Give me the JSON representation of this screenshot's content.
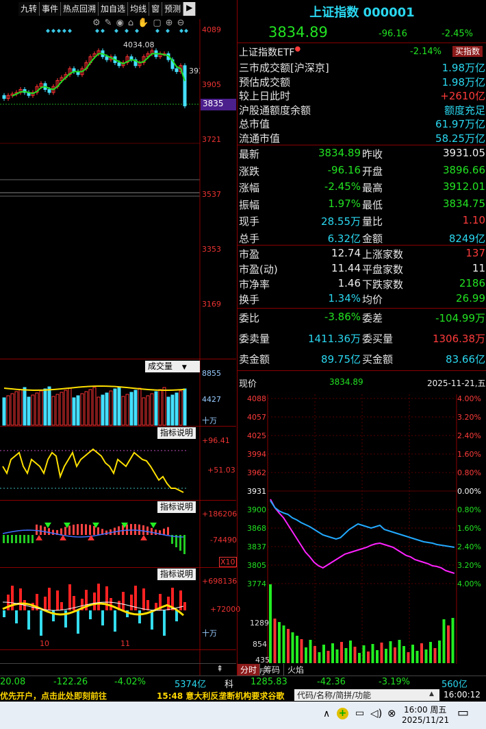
{
  "toolbar": [
    "九转",
    "事件",
    "热点回溯",
    "加自选",
    "均线",
    "窗",
    "预测",
    "▶"
  ],
  "kline": {
    "price_labels": [
      "4089",
      "3905",
      "3721",
      "3537",
      "3353",
      "3169"
    ],
    "current_tag": "3835",
    "high_annot": "4034.08",
    "right_annot": "393",
    "month_labels": [
      "10",
      "11"
    ]
  },
  "volume": {
    "btn": "成交量",
    "labels": [
      "8855",
      "4427"
    ],
    "unit": "十万"
  },
  "ind1": {
    "btn": "指标说明",
    "labels": [
      "+96.41",
      "+51.03"
    ]
  },
  "ind2": {
    "btn": "指标说明",
    "labels": [
      "+186206",
      "-74490"
    ],
    "x10": "X10"
  },
  "ind3": {
    "btn": "指标说明",
    "labels": [
      "+698136",
      "+72000"
    ],
    "unit": "十万"
  },
  "header": {
    "title": "上证指数 000001",
    "price": "3834.89",
    "change": "-96.16",
    "pct": "-2.45%"
  },
  "etf": {
    "label": "上证指数ETF",
    "pct": "-2.14%",
    "btn": "买指数"
  },
  "market": [
    {
      "label": "三市成交额[沪深京]",
      "value": "1.98万亿"
    },
    {
      "label": "预估成交额",
      "value": "1.98万亿"
    },
    {
      "label": "较上日此时",
      "value": "+2610亿"
    },
    {
      "label": "沪股通额度余额",
      "value": "额度充足"
    },
    {
      "label": "总市值",
      "value": "61.97万亿"
    },
    {
      "label": "流通市值",
      "value": "58.25万亿"
    }
  ],
  "quote": [
    {
      "l1": "最新",
      "v1": "3834.89",
      "l2": "昨收",
      "v2": "3931.05"
    },
    {
      "l1": "涨跌",
      "v1": "-96.16",
      "l2": "开盘",
      "v2": "3896.66"
    },
    {
      "l1": "涨幅",
      "v1": "-2.45%",
      "l2": "最高",
      "v2": "3912.01"
    },
    {
      "l1": "振幅",
      "v1": "1.97%",
      "l2": "最低",
      "v2": "3834.75"
    },
    {
      "l1": "现手",
      "v1": "28.55万",
      "l2": "量比",
      "v2": "1.10"
    },
    {
      "l1": "总手",
      "v1": "6.32亿",
      "l2": "金额",
      "v2": "8249亿"
    }
  ],
  "stats": [
    {
      "l1": "市盈",
      "v1": "12.74",
      "l2": "上涨家数",
      "v2": "137"
    },
    {
      "l1": "市盈(动)",
      "v1": "11.44",
      "l2": "平盘家数",
      "v2": "11"
    },
    {
      "l1": "市净率",
      "v1": "1.46",
      "l2": "下跌家数",
      "v2": "2186"
    },
    {
      "l1": "换手",
      "v1": "1.34%",
      "l2": "均价",
      "v2": "26.99"
    }
  ],
  "order": [
    {
      "l1": "委比",
      "v1": "-3.86%",
      "l2": "委差",
      "v2": "-104.99万"
    },
    {
      "l1": "委卖量",
      "v1": "1411.36万",
      "l2": "委买量",
      "v2": "1306.38万"
    },
    {
      "l1": "卖金额",
      "v1": "89.75亿",
      "l2": "买金额",
      "v2": "83.66亿"
    }
  ],
  "intraday": {
    "label": "现价",
    "price": "3834.89",
    "date": "2025-11-21,五",
    "left_labels": [
      "4088",
      "4057",
      "4025",
      "3994",
      "3962",
      "3931",
      "3900",
      "3868",
      "3837",
      "3805",
      "3774"
    ],
    "right_labels": [
      "4.00%",
      "3.20%",
      "2.40%",
      "1.60%",
      "0.80%",
      "0.00%",
      "0.80%",
      "1.60%",
      "2.40%",
      "3.20%",
      "4.00%"
    ],
    "vol_labels": [
      "1289",
      "854",
      "435"
    ],
    "vol_unit": "万",
    "tabs": [
      "分时",
      "筹码",
      "火焰"
    ]
  },
  "status": [
    "20.08",
    "-122.26",
    "-4.02%",
    "5374亿",
    "科",
    "1285.83",
    "-42.36",
    "-3.19%",
    "560亿"
  ],
  "ticker": {
    "left": "优先开户，点击此处即刻前往",
    "news": "15:48 意大利反垄断机构要求谷歌",
    "search_placeholder": "代码/名称/简拼/功能",
    "time": "16:00:12"
  },
  "taskbar": {
    "time": "16:00 周五",
    "date": "2025/11/21"
  }
}
